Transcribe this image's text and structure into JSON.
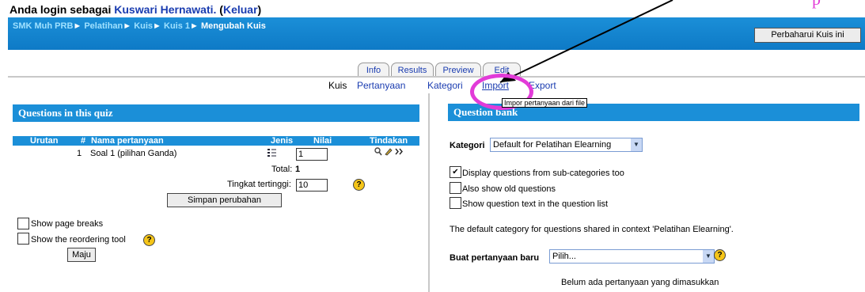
{
  "header": {
    "login_prefix": "Anda login sebagai",
    "user_name": "Kuswari Hernawati.",
    "logout_open": "(",
    "logout_label": "Keluar",
    "logout_close": ")"
  },
  "breadcrumb": {
    "items": [
      "SMK Muh PRB",
      "Pelatihan",
      "Kuis",
      "Kuis 1"
    ],
    "separator": "►",
    "current": "Mengubah Kuis"
  },
  "update_button": "Perbaharui Kuis ini",
  "tabs": [
    "Info",
    "Results",
    "Preview",
    "Edit"
  ],
  "subtabs": [
    "Kuis",
    "Pertanyaan",
    "Kategori",
    "Import",
    "Export"
  ],
  "tooltip": "Impor pertanyaan dari file",
  "left_panel": {
    "title": "Questions in this quiz",
    "columns": [
      "Urutan",
      "#",
      "Nama pertanyaan",
      "Jenis",
      "Nilai",
      "Tindakan"
    ],
    "rows": [
      {
        "number": "1",
        "name": "Soal 1 (pilihan Ganda)",
        "type_icon": "multichoice-list-icon",
        "grade": "1",
        "actions": [
          "preview-icon",
          "edit-icon",
          "move-icon"
        ]
      }
    ],
    "total_label": "Total:",
    "total_value": "1",
    "max_grade_label": "Tingkat tertinggi:",
    "max_grade_value": "10",
    "save_button": "Simpan perubahan",
    "show_page_breaks": "Show page breaks",
    "show_reordering": "Show the reordering tool",
    "go_button": "Maju"
  },
  "right_panel": {
    "title": "Question bank",
    "category_label": "Kategori",
    "category_value": "Default for Pelatihan Elearning",
    "opt_subcategories": "Display questions from sub-categories too",
    "opt_subcategories_checked": true,
    "opt_old": "Also show old questions",
    "opt_text": "Show question text in the question list",
    "default_note": "The default category for questions shared in context 'Pelatihan Elearning'.",
    "create_label": "Buat pertanyaan baru",
    "create_value": "Pilih...",
    "empty_note": "Belum ada pertanyaan yang dimasukkan"
  },
  "colors": {
    "bar_blue": "#1b8fd8",
    "link": "#1a3cb0",
    "annotation": "#e23bd8"
  },
  "annotation": {
    "label": "p"
  }
}
